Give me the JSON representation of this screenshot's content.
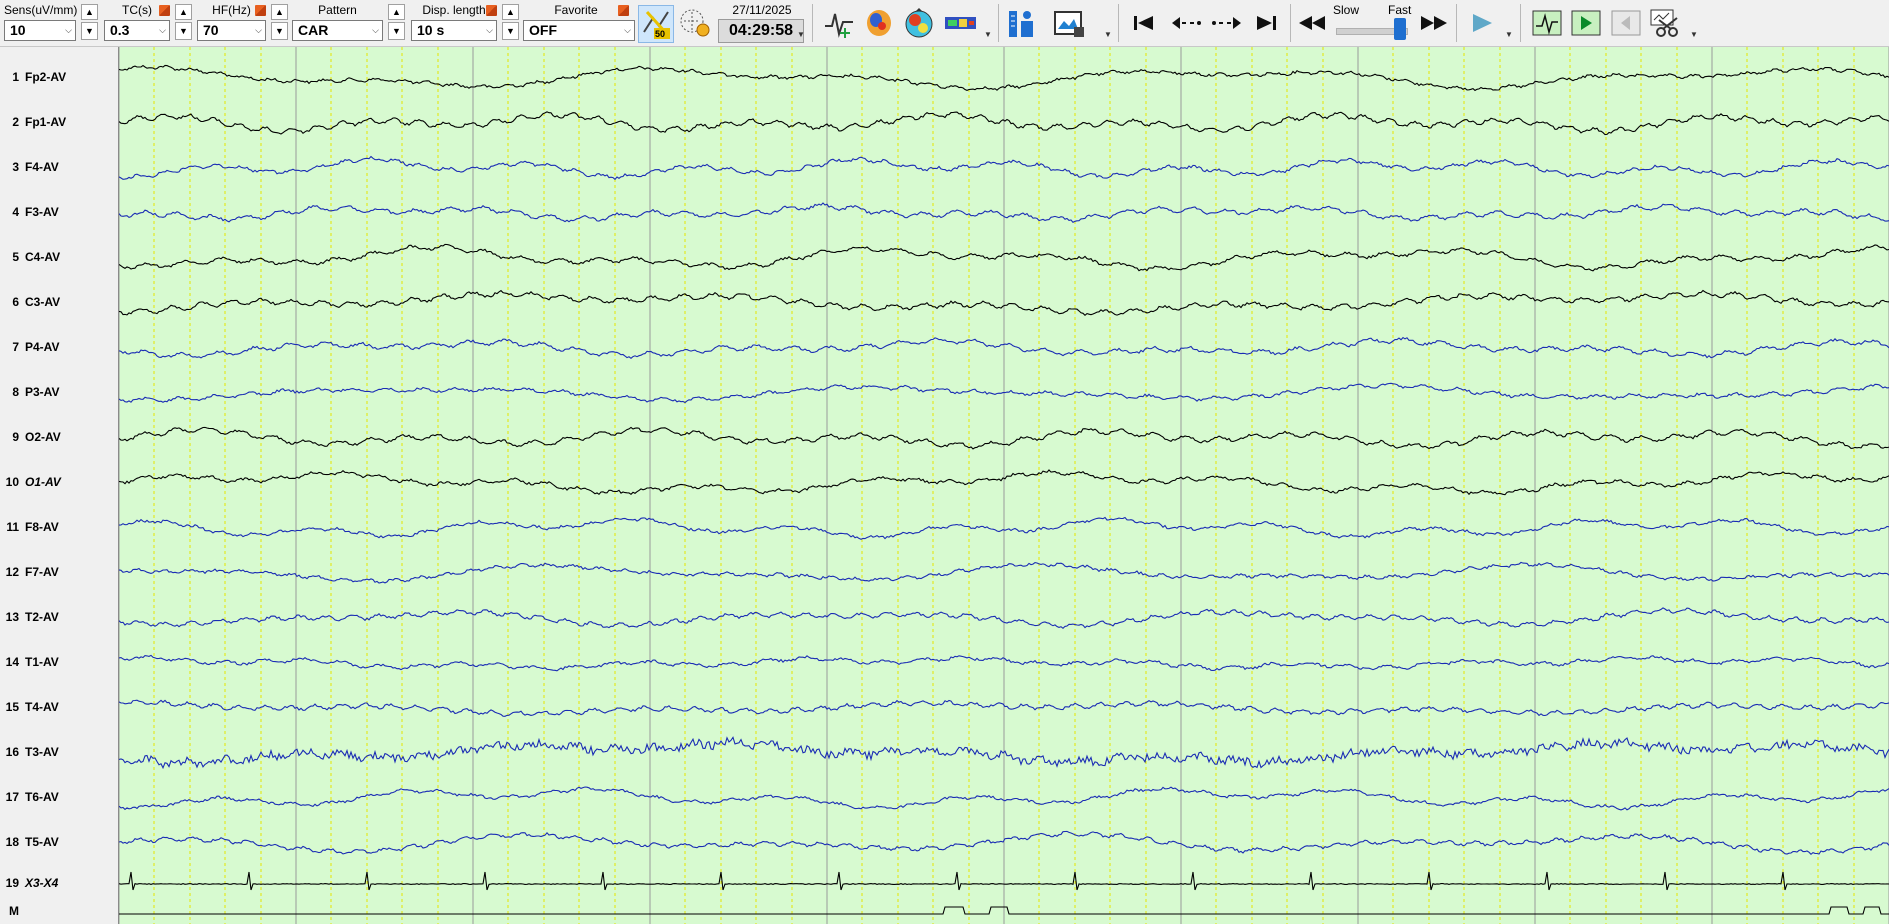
{
  "toolbar": {
    "sensitivity": {
      "label": "Sens(uV/mm)",
      "value": "10"
    },
    "time_constant": {
      "label": "TC(s)",
      "value": "0.3"
    },
    "high_filter": {
      "label": "HF(Hz)",
      "value": "70"
    },
    "pattern": {
      "label": "Pattern",
      "value": "CAR"
    },
    "display_length": {
      "label": "Disp. length",
      "value": "10 s"
    },
    "favorite": {
      "label": "Favorite",
      "value": "OFF"
    },
    "notch_badge": "50",
    "date": "27/11/2025",
    "time": "04:29:58",
    "speed_slow_label": "Slow",
    "speed_fast_label": "Fast",
    "speed_level": 0.9
  },
  "channels": [
    {
      "num": "1",
      "name": "Fp2-AV",
      "color": "#000000"
    },
    {
      "num": "2",
      "name": "Fp1-AV",
      "color": "#000000"
    },
    {
      "num": "3",
      "name": "F4-AV",
      "color": "#1a2cb4"
    },
    {
      "num": "4",
      "name": "F3-AV",
      "color": "#1a2cb4"
    },
    {
      "num": "5",
      "name": "C4-AV",
      "color": "#000000"
    },
    {
      "num": "6",
      "name": "C3-AV",
      "color": "#000000"
    },
    {
      "num": "7",
      "name": "P4-AV",
      "color": "#1a2cb4"
    },
    {
      "num": "8",
      "name": "P3-AV",
      "color": "#1a2cb4"
    },
    {
      "num": "9",
      "name": "O2-AV",
      "color": "#000000"
    },
    {
      "num": "10",
      "name": "O1-AV",
      "color": "#000000",
      "italic": true
    },
    {
      "num": "11",
      "name": "F8-AV",
      "color": "#1a2cb4"
    },
    {
      "num": "12",
      "name": "F7-AV",
      "color": "#1a2cb4"
    },
    {
      "num": "13",
      "name": "T2-AV",
      "color": "#1a2cb4"
    },
    {
      "num": "14",
      "name": "T1-AV",
      "color": "#1a2cb4"
    },
    {
      "num": "15",
      "name": "T4-AV",
      "color": "#1a2cb4"
    },
    {
      "num": "16",
      "name": "T3-AV",
      "color": "#1a2cb4"
    },
    {
      "num": "17",
      "name": "T6-AV",
      "color": "#1a2cb4"
    },
    {
      "num": "18",
      "name": "T5-AV",
      "color": "#1a2cb4"
    },
    {
      "num": "19",
      "name": "X3-X4",
      "color": "#000000",
      "italic": true
    },
    {
      "num": "M",
      "name": "",
      "color": "#000000"
    }
  ],
  "colors": {
    "background": "#d7fad0",
    "second_gridline": "#9a9a9a",
    "subdivision_gridline": "#e6e600"
  }
}
